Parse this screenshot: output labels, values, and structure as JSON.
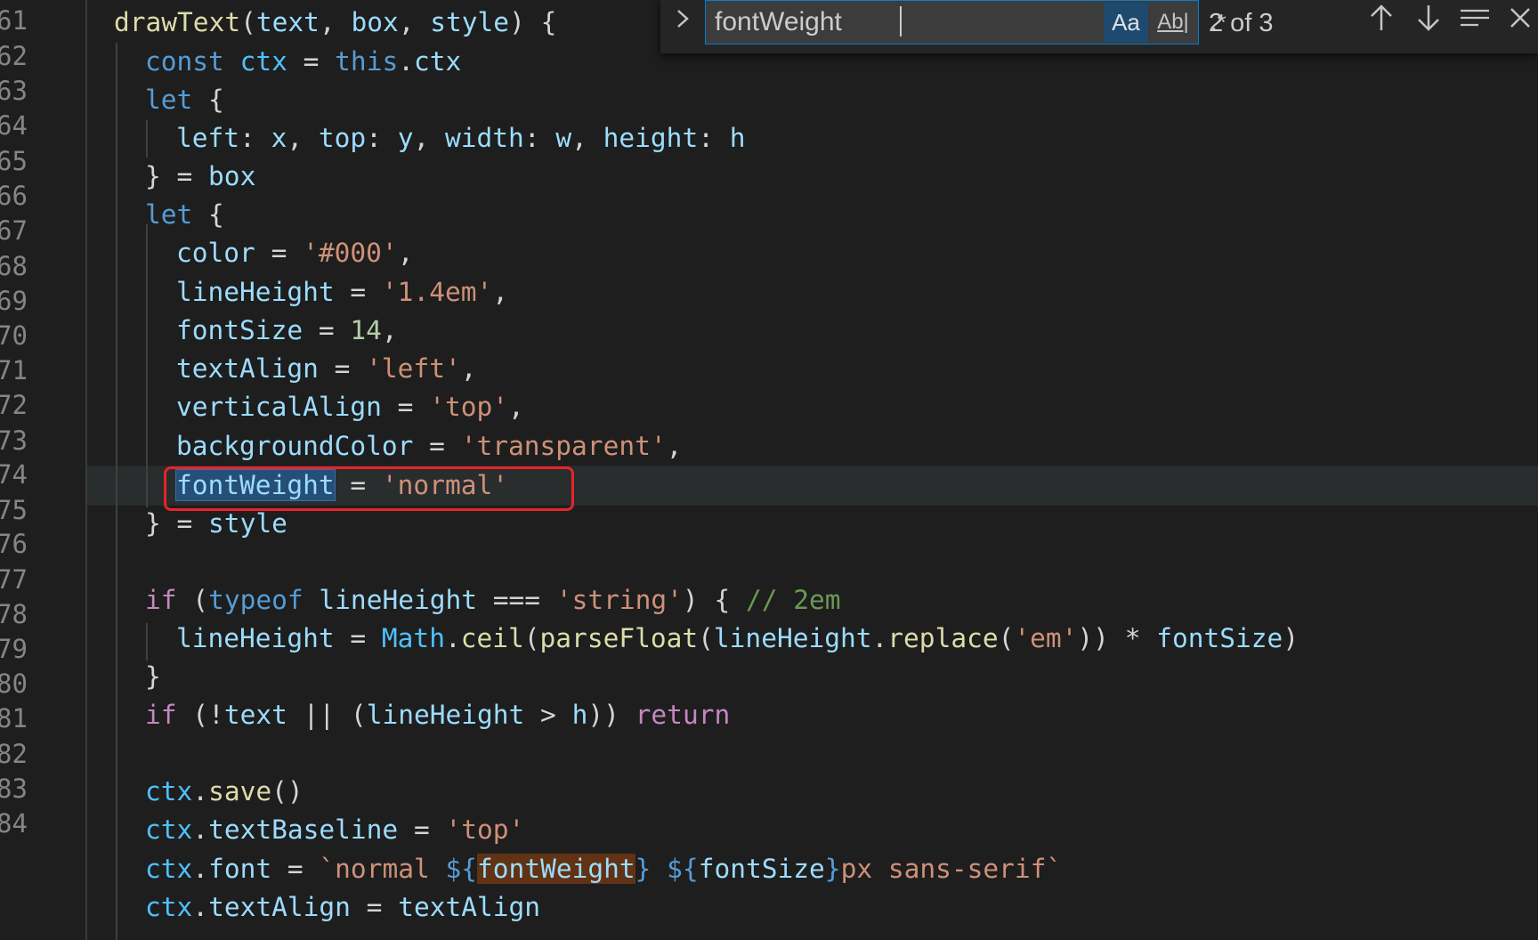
{
  "line_numbers": [
    "61",
    "62",
    "63",
    "64",
    "65",
    "66",
    "67",
    "68",
    "69",
    "70",
    "71",
    "72",
    "73",
    "74",
    "75",
    "76",
    "77",
    "78",
    "79",
    "80",
    "81",
    "82",
    "83",
    "84"
  ],
  "code": {
    "l61": {
      "fn": "drawText",
      "open": "(",
      "p1": "text",
      "c1": ", ",
      "p2": "box",
      "c2": ", ",
      "p3": "style",
      "close": ") {"
    },
    "l62": {
      "kw": "const",
      "sp": " ",
      "name": "ctx",
      "eq": " = ",
      "this": "this",
      "dot": ".",
      "prop": "ctx"
    },
    "l63": {
      "kw": "let",
      "rest": " {"
    },
    "l64": {
      "k1": "left",
      "s1": ": ",
      "v1": "x",
      "s2": ", ",
      "k2": "top",
      "s3": ": ",
      "v2": "y",
      "s4": ", ",
      "k3": "width",
      "s5": ": ",
      "v3": "w",
      "s6": ", ",
      "k4": "height",
      "s7": ": ",
      "v4": "h"
    },
    "l65": {
      "brace": "} = ",
      "name": "box"
    },
    "l66": {
      "kw": "let",
      "rest": " {"
    },
    "l67": {
      "name": "color",
      "eq": " = ",
      "val": "'#000'",
      "comma": ","
    },
    "l68": {
      "name": "lineHeight",
      "eq": " = ",
      "val": "'1.4em'",
      "comma": ","
    },
    "l69": {
      "name": "fontSize",
      "eq": " = ",
      "val": "14",
      "comma": ","
    },
    "l70": {
      "name": "textAlign",
      "eq": " = ",
      "val": "'left'",
      "comma": ","
    },
    "l71": {
      "name": "verticalAlign",
      "eq": " = ",
      "val": "'top'",
      "comma": ","
    },
    "l72": {
      "name": "backgroundColor",
      "eq": " = ",
      "val": "'transparent'",
      "comma": ","
    },
    "l73": {
      "name": "fontWeight",
      "eq": " = ",
      "val": "'normal'"
    },
    "l74": {
      "brace": "} = ",
      "name": "style"
    },
    "l76": {
      "kw": "if",
      "open": " (",
      "typeof": "typeof",
      "sp": " ",
      "name": "lineHeight",
      "op": " === ",
      "val": "'string'",
      "close": ") { ",
      "cmt": "// 2em"
    },
    "l77": {
      "name": "lineHeight",
      "eq": " = ",
      "math": "Math",
      "dot1": ".",
      "ceil": "ceil",
      "o1": "(",
      "pf": "parseFloat",
      "o2": "(",
      "name2": "lineHeight",
      "dot2": ".",
      "rep": "replace",
      "o3": "(",
      "val": "'em'",
      "c1": ")) * ",
      "fs": "fontSize",
      "c2": ")"
    },
    "l78": {
      "brace": "}"
    },
    "l79": {
      "kw": "if",
      "o1": " (!",
      "text": "text",
      "op": " || (",
      "lh": "lineHeight",
      "gt": " > ",
      "h": "h",
      "c1": ")) ",
      "ret": "return"
    },
    "l81": {
      "ctx": "ctx",
      "dot": ".",
      "fn": "save",
      "args": "()"
    },
    "l82": {
      "ctx": "ctx",
      "dot": ".",
      "prop": "textBaseline",
      "eq": " = ",
      "val": "'top'"
    },
    "l83": {
      "ctx": "ctx",
      "dot": ".",
      "prop": "font",
      "eq": " = ",
      "t1": "`normal ",
      "d1": "${",
      "fw": "fontWeight",
      "e1": "}",
      "t2": " ",
      "d2": "${",
      "fs": "fontSize",
      "e2": "}",
      "t3": "px sans-serif`"
    },
    "l84": {
      "ctx": "ctx",
      "dot": ".",
      "prop": "textAlign",
      "eq": " = ",
      "val": "textAlign"
    }
  },
  "find_widget": {
    "query": "fontWeight",
    "match_case_label": "Aa",
    "whole_word_label": "Ab|",
    "regex_label": ".*",
    "match_count": "2 of 3",
    "toggle_icon": "chevron-right-icon",
    "prev_icon": "arrow-up-icon",
    "next_icon": "arrow-down-icon",
    "selection_icon": "find-in-selection-icon",
    "close_icon": "close-icon"
  },
  "colors": {
    "background": "#1e1e1e",
    "keyword": "#569cd6",
    "control": "#c586c0",
    "function": "#dcdcaa",
    "variable": "#9cdcfe",
    "string": "#ce9178",
    "number": "#b5cea8",
    "comment": "#6a9955",
    "annotation": "#e8232a"
  }
}
